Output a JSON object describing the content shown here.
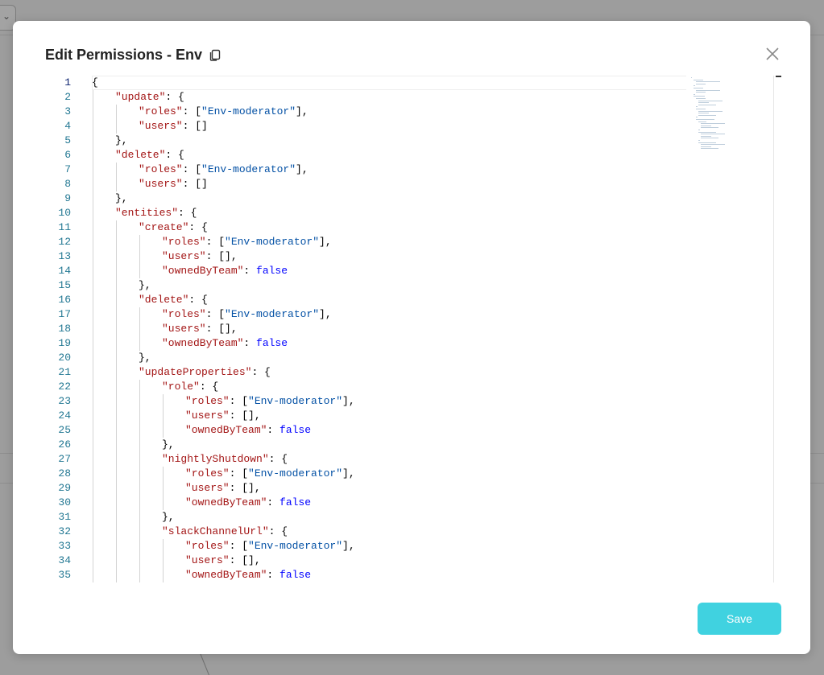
{
  "modal": {
    "title": "Edit Permissions - Env",
    "save_label": "Save"
  },
  "editor": {
    "language": "json",
    "current_line": 1,
    "lines": [
      {
        "n": "1",
        "indent": 0,
        "tokens": [
          [
            "p",
            "{"
          ]
        ]
      },
      {
        "n": "2",
        "indent": 1,
        "tokens": [
          [
            "k",
            "\"update\""
          ],
          [
            "p",
            ": {"
          ]
        ]
      },
      {
        "n": "3",
        "indent": 2,
        "tokens": [
          [
            "k",
            "\"roles\""
          ],
          [
            "p",
            ": ["
          ],
          [
            "s",
            "\"Env-moderator\""
          ],
          [
            "p",
            "],"
          ]
        ]
      },
      {
        "n": "4",
        "indent": 2,
        "tokens": [
          [
            "k",
            "\"users\""
          ],
          [
            "p",
            ": []"
          ]
        ]
      },
      {
        "n": "5",
        "indent": 1,
        "tokens": [
          [
            "p",
            "},"
          ]
        ]
      },
      {
        "n": "6",
        "indent": 1,
        "tokens": [
          [
            "k",
            "\"delete\""
          ],
          [
            "p",
            ": {"
          ]
        ]
      },
      {
        "n": "7",
        "indent": 2,
        "tokens": [
          [
            "k",
            "\"roles\""
          ],
          [
            "p",
            ": ["
          ],
          [
            "s",
            "\"Env-moderator\""
          ],
          [
            "p",
            "],"
          ]
        ]
      },
      {
        "n": "8",
        "indent": 2,
        "tokens": [
          [
            "k",
            "\"users\""
          ],
          [
            "p",
            ": []"
          ]
        ]
      },
      {
        "n": "9",
        "indent": 1,
        "tokens": [
          [
            "p",
            "},"
          ]
        ]
      },
      {
        "n": "10",
        "indent": 1,
        "tokens": [
          [
            "k",
            "\"entities\""
          ],
          [
            "p",
            ": {"
          ]
        ]
      },
      {
        "n": "11",
        "indent": 2,
        "tokens": [
          [
            "k",
            "\"create\""
          ],
          [
            "p",
            ": {"
          ]
        ]
      },
      {
        "n": "12",
        "indent": 3,
        "tokens": [
          [
            "k",
            "\"roles\""
          ],
          [
            "p",
            ": ["
          ],
          [
            "s",
            "\"Env-moderator\""
          ],
          [
            "p",
            "],"
          ]
        ]
      },
      {
        "n": "13",
        "indent": 3,
        "tokens": [
          [
            "k",
            "\"users\""
          ],
          [
            "p",
            ": [],"
          ]
        ]
      },
      {
        "n": "14",
        "indent": 3,
        "tokens": [
          [
            "k",
            "\"ownedByTeam\""
          ],
          [
            "p",
            ": "
          ],
          [
            "b",
            "false"
          ]
        ]
      },
      {
        "n": "15",
        "indent": 2,
        "tokens": [
          [
            "p",
            "},"
          ]
        ]
      },
      {
        "n": "16",
        "indent": 2,
        "tokens": [
          [
            "k",
            "\"delete\""
          ],
          [
            "p",
            ": {"
          ]
        ]
      },
      {
        "n": "17",
        "indent": 3,
        "tokens": [
          [
            "k",
            "\"roles\""
          ],
          [
            "p",
            ": ["
          ],
          [
            "s",
            "\"Env-moderator\""
          ],
          [
            "p",
            "],"
          ]
        ]
      },
      {
        "n": "18",
        "indent": 3,
        "tokens": [
          [
            "k",
            "\"users\""
          ],
          [
            "p",
            ": [],"
          ]
        ]
      },
      {
        "n": "19",
        "indent": 3,
        "tokens": [
          [
            "k",
            "\"ownedByTeam\""
          ],
          [
            "p",
            ": "
          ],
          [
            "b",
            "false"
          ]
        ]
      },
      {
        "n": "20",
        "indent": 2,
        "tokens": [
          [
            "p",
            "},"
          ]
        ]
      },
      {
        "n": "21",
        "indent": 2,
        "tokens": [
          [
            "k",
            "\"updateProperties\""
          ],
          [
            "p",
            ": {"
          ]
        ]
      },
      {
        "n": "22",
        "indent": 3,
        "tokens": [
          [
            "k",
            "\"role\""
          ],
          [
            "p",
            ": {"
          ]
        ]
      },
      {
        "n": "23",
        "indent": 4,
        "tokens": [
          [
            "k",
            "\"roles\""
          ],
          [
            "p",
            ": ["
          ],
          [
            "s",
            "\"Env-moderator\""
          ],
          [
            "p",
            "],"
          ]
        ]
      },
      {
        "n": "24",
        "indent": 4,
        "tokens": [
          [
            "k",
            "\"users\""
          ],
          [
            "p",
            ": [],"
          ]
        ]
      },
      {
        "n": "25",
        "indent": 4,
        "tokens": [
          [
            "k",
            "\"ownedByTeam\""
          ],
          [
            "p",
            ": "
          ],
          [
            "b",
            "false"
          ]
        ]
      },
      {
        "n": "26",
        "indent": 3,
        "tokens": [
          [
            "p",
            "},"
          ]
        ]
      },
      {
        "n": "27",
        "indent": 3,
        "tokens": [
          [
            "k",
            "\"nightlyShutdown\""
          ],
          [
            "p",
            ": {"
          ]
        ]
      },
      {
        "n": "28",
        "indent": 4,
        "tokens": [
          [
            "k",
            "\"roles\""
          ],
          [
            "p",
            ": ["
          ],
          [
            "s",
            "\"Env-moderator\""
          ],
          [
            "p",
            "],"
          ]
        ]
      },
      {
        "n": "29",
        "indent": 4,
        "tokens": [
          [
            "k",
            "\"users\""
          ],
          [
            "p",
            ": [],"
          ]
        ]
      },
      {
        "n": "30",
        "indent": 4,
        "tokens": [
          [
            "k",
            "\"ownedByTeam\""
          ],
          [
            "p",
            ": "
          ],
          [
            "b",
            "false"
          ]
        ]
      },
      {
        "n": "31",
        "indent": 3,
        "tokens": [
          [
            "p",
            "},"
          ]
        ]
      },
      {
        "n": "32",
        "indent": 3,
        "tokens": [
          [
            "k",
            "\"slackChannelUrl\""
          ],
          [
            "p",
            ": {"
          ]
        ]
      },
      {
        "n": "33",
        "indent": 4,
        "tokens": [
          [
            "k",
            "\"roles\""
          ],
          [
            "p",
            ": ["
          ],
          [
            "s",
            "\"Env-moderator\""
          ],
          [
            "p",
            "],"
          ]
        ]
      },
      {
        "n": "34",
        "indent": 4,
        "tokens": [
          [
            "k",
            "\"users\""
          ],
          [
            "p",
            ": [],"
          ]
        ]
      },
      {
        "n": "35",
        "indent": 4,
        "tokens": [
          [
            "k",
            "\"ownedByTeam\""
          ],
          [
            "p",
            ": "
          ],
          [
            "b",
            "false"
          ]
        ]
      }
    ]
  },
  "colors": {
    "accent": "#40d2e0",
    "json_key": "#a31515",
    "json_string": "#0451a5",
    "json_boolean": "#0000ff",
    "line_number": "#237893"
  },
  "icons": {
    "copy": "copy-icon",
    "close": "close-icon",
    "dropdown": "chevron-down-icon"
  }
}
